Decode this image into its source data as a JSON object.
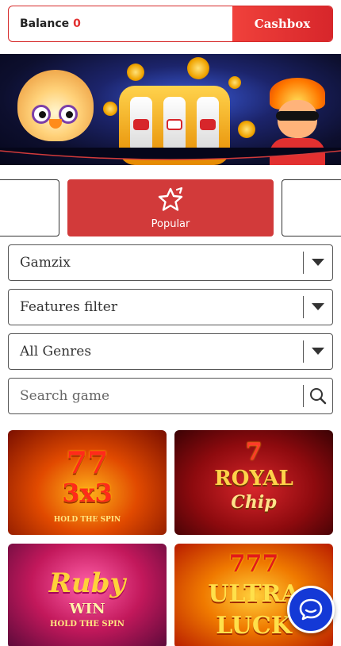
{
  "header": {
    "balance_label": "Balance",
    "balance_value": "0",
    "cashbox_label": "Cashbox"
  },
  "categories": {
    "active_label": "Popular"
  },
  "filters": {
    "provider": "Gamzix",
    "features": "Features filter",
    "genres": "All Genres",
    "search_placeholder": "Search game"
  },
  "games": [
    {
      "title_line1": "77",
      "title_line2": "3x3",
      "subtitle": "HOLD THE SPIN"
    },
    {
      "title_line1": "7",
      "title_line2": "ROYAL",
      "subtitle": "Chip"
    },
    {
      "title_line1": "Ruby",
      "title_line2": "WIN",
      "subtitle": "HOLD THE SPIN"
    },
    {
      "title_line1": "777",
      "title_line2": "ULTRA",
      "subtitle": "LUCK"
    }
  ],
  "colors": {
    "accent": "#d7262b",
    "chat": "#1439d6"
  },
  "icons": {
    "popular": "star-icon",
    "dropdown": "chevron-down-icon",
    "search": "search-icon",
    "chat": "chat-icon"
  }
}
